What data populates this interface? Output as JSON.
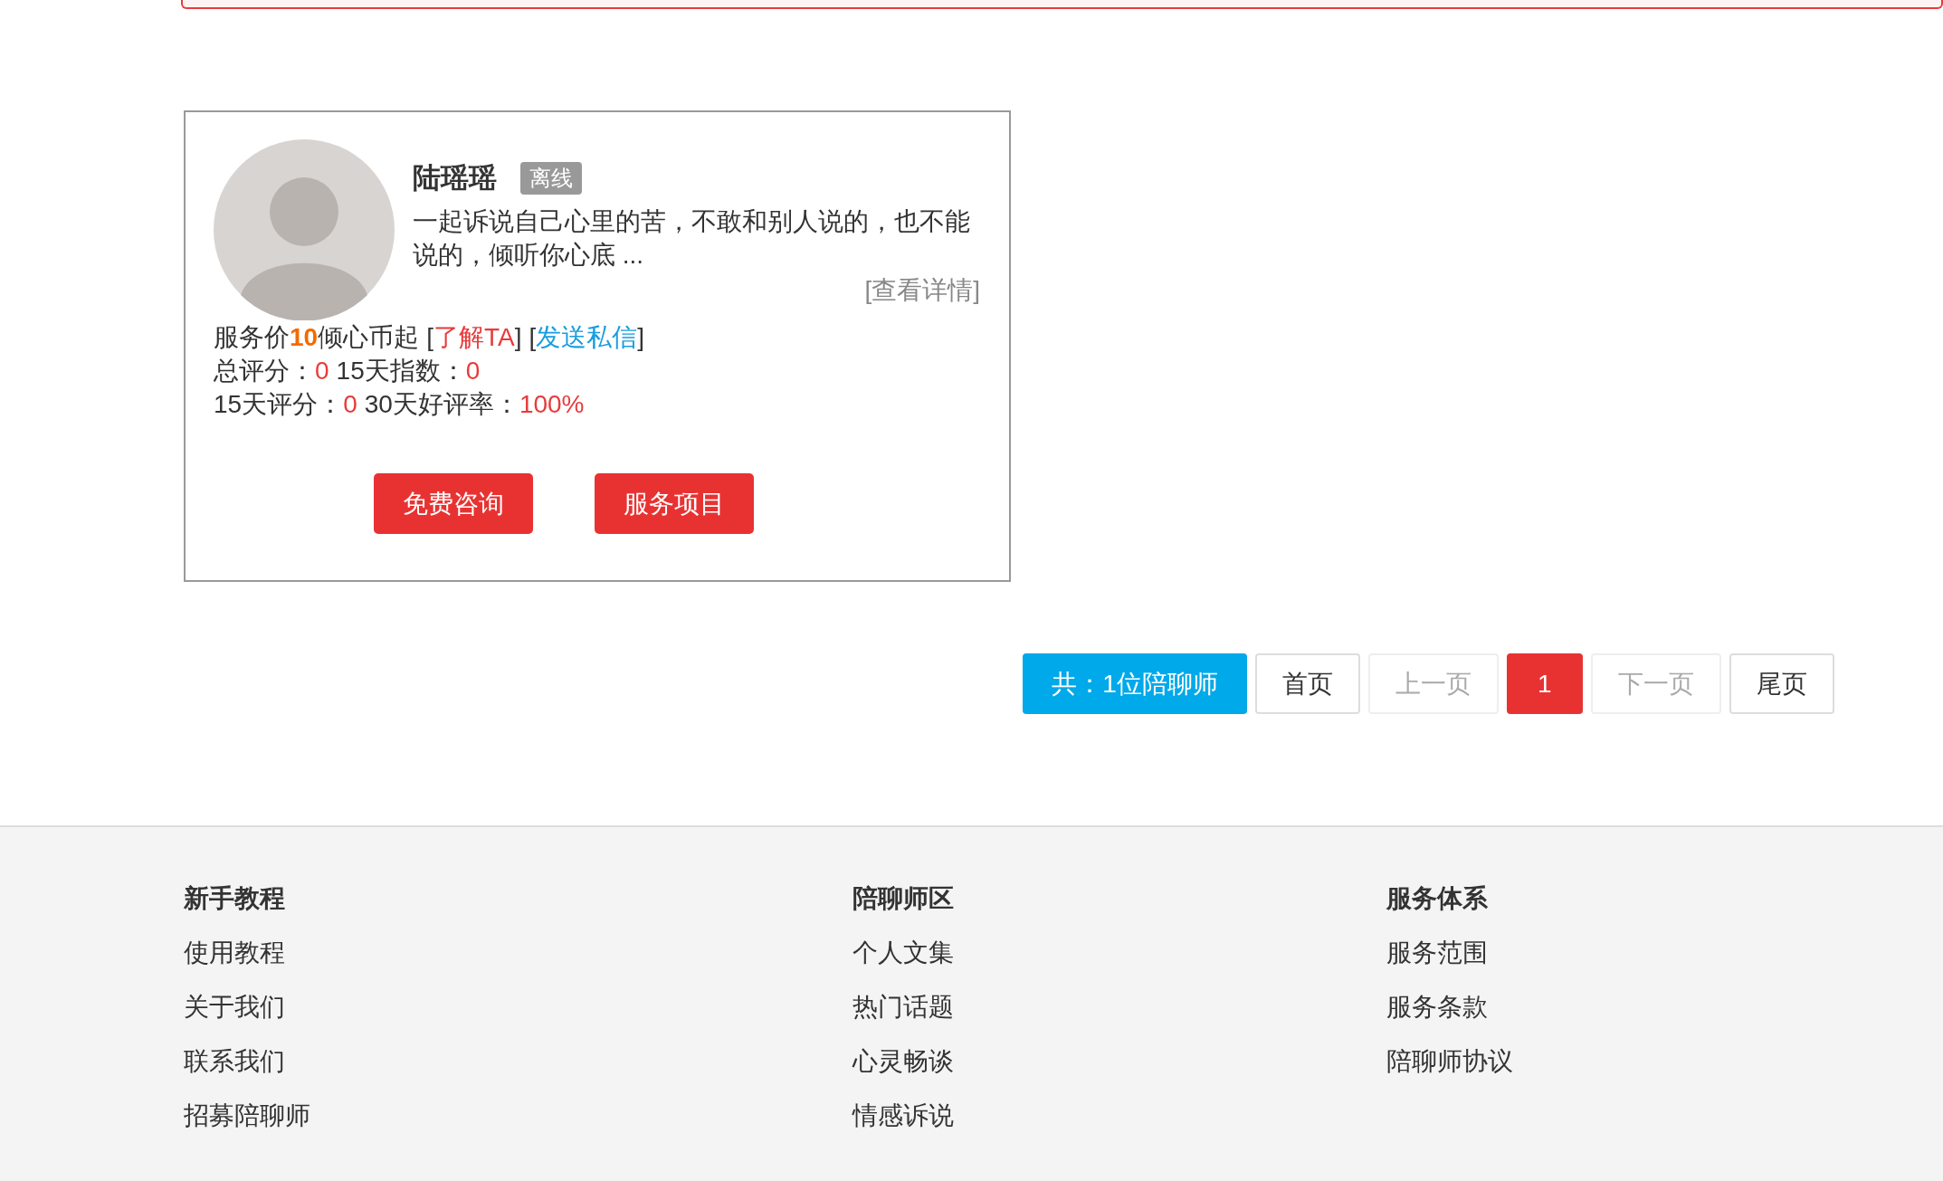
{
  "counsellor": {
    "name": "陆瑶瑶",
    "online": false,
    "status": "离线",
    "intro": "一起诉说自己心里的苦，不敢和别人说的，也不能说的，倾听你心底 ...",
    "details_link": "[查看详情]",
    "price_prefix": "服务价",
    "price": "10",
    "price_suffix": "倾心币起",
    "links": [
      {
        "kind": "about",
        "open": "[",
        "label": "了解TA",
        "close": "]"
      },
      {
        "kind": "message",
        "open": "[",
        "label": "发送私信",
        "close": "]"
      }
    ],
    "stat_rows": [
      [
        {
          "label": "总评分：",
          "value": "0"
        },
        {
          "label": "15天指数：",
          "value": "0"
        }
      ],
      [
        {
          "label": "15天评分：",
          "value": "0"
        },
        {
          "label": "30天好评率：",
          "value": "100%"
        }
      ]
    ],
    "buttons": [
      "免费咨询",
      "服务项目"
    ]
  },
  "pagination": {
    "total": "共：1位陪聊师",
    "pages": [
      {
        "label": "首页",
        "selected": false,
        "disabled": false
      },
      {
        "label": "上一页",
        "selected": false,
        "disabled": true
      },
      {
        "label": "1",
        "selected": true,
        "disabled": false
      },
      {
        "label": "下一页",
        "selected": false,
        "disabled": true
      },
      {
        "label": "尾页",
        "selected": false,
        "disabled": false
      }
    ]
  },
  "footer": {
    "columns": [
      {
        "heading": "新手教程",
        "links": [
          "使用教程",
          "关于我们",
          "联系我们",
          "招募陪聊师"
        ]
      },
      {
        "heading": "陪聊师区",
        "links": [
          "个人文集",
          "热门话题",
          "心灵畅谈",
          "情感诉说"
        ]
      },
      {
        "heading": "服务体系",
        "links": [
          "服务范围",
          "服务条款",
          "陪聊师协议"
        ]
      }
    ]
  }
}
